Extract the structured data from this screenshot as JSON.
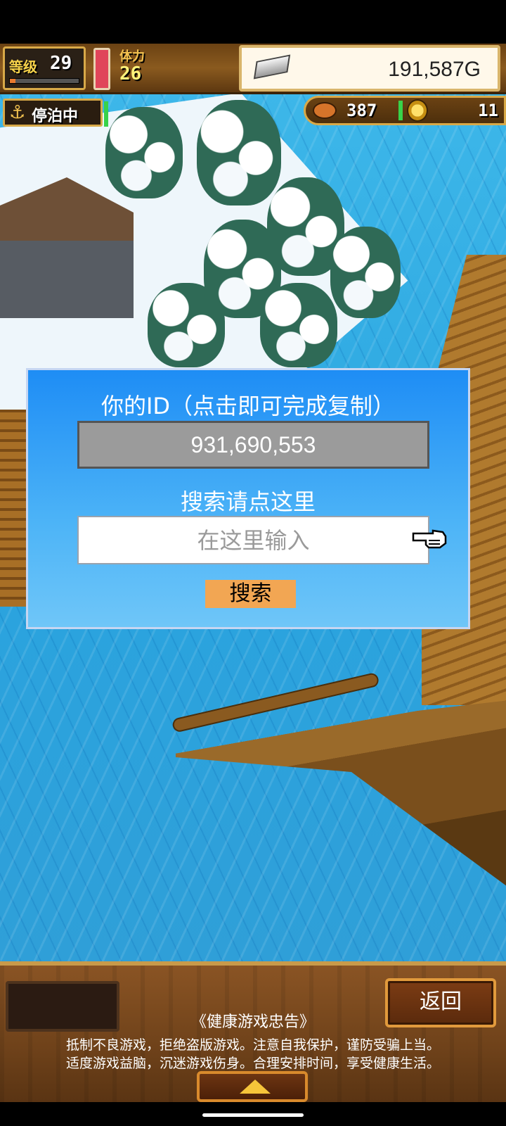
{
  "hud": {
    "level_label": "等级",
    "level": "29",
    "level_progress": 0.08,
    "stamina_label": "体力",
    "stamina": "26",
    "stamina_fill": 1.0,
    "gold": "191,587G",
    "status": "停泊中",
    "food": "387",
    "medals": "11"
  },
  "dialog": {
    "title": "你的ID（点击即可完成复制）",
    "user_id": "931,690,553",
    "search_label": "搜索请点这里",
    "search_placeholder": "在这里输入",
    "search_button": "搜索"
  },
  "bottom": {
    "back_button": "返回",
    "notice_title": "《健康游戏忠告》",
    "notice_line1": "抵制不良游戏，拒绝盗版游戏。注意自我保护，谨防受骗上当。",
    "notice_line2": "适度游戏益脑，沉迷游戏伤身。合理安排时间，享受健康生活。"
  },
  "colors": {
    "dialog_top": "#1e8df5",
    "dialog_bottom": "#6fc6f8",
    "search_button": "#f2a653",
    "sea": "#2aa4df"
  },
  "icons": [
    "anchor-icon",
    "silver-ingot-icon",
    "meat-icon",
    "medal-icon",
    "pointing-hand-icon",
    "up-arrow-icon"
  ]
}
